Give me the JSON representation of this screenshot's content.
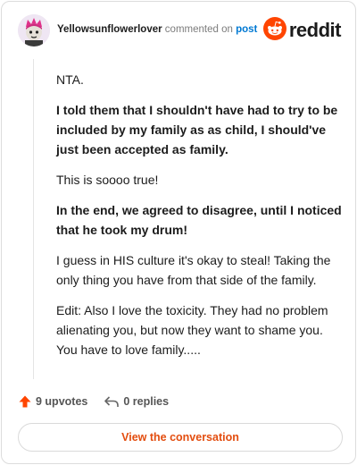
{
  "header": {
    "username": "Yellowsunflowerlover",
    "action_text": "commented on",
    "link_text": "post",
    "brand_text": "reddit"
  },
  "comment": {
    "paragraphs": [
      {
        "text": "NTA.",
        "bold": false
      },
      {
        "text": "I told them that I shouldn't have had to try to be included by my family as as child, I should've just been accepted as family.",
        "bold": true
      },
      {
        "text": "This is soooo true!",
        "bold": false
      },
      {
        "text": "In the end, we agreed to disagree, until I noticed that he took my drum!",
        "bold": true
      },
      {
        "text": "I guess in HIS culture it's okay to steal! Taking the only thing you have from that side of the family.",
        "bold": false
      },
      {
        "text": "Edit: Also I love the toxicity. They had no problem alienating you, but now they want to shame you. You have to love family.....",
        "bold": false
      }
    ]
  },
  "footer": {
    "upvotes_label": "9 upvotes",
    "replies_label": "0 replies",
    "cta_label": "View the conversation"
  },
  "colors": {
    "brand_orange": "#ff4500",
    "upvote_orange": "#ff4500",
    "link_blue": "#0079d3",
    "cta_text": "#e34d0f"
  },
  "icons": {
    "avatar": "avatar-icon",
    "brand": "reddit-logo-icon",
    "upvote": "upvote-arrow-icon",
    "reply": "reply-arrow-icon"
  }
}
